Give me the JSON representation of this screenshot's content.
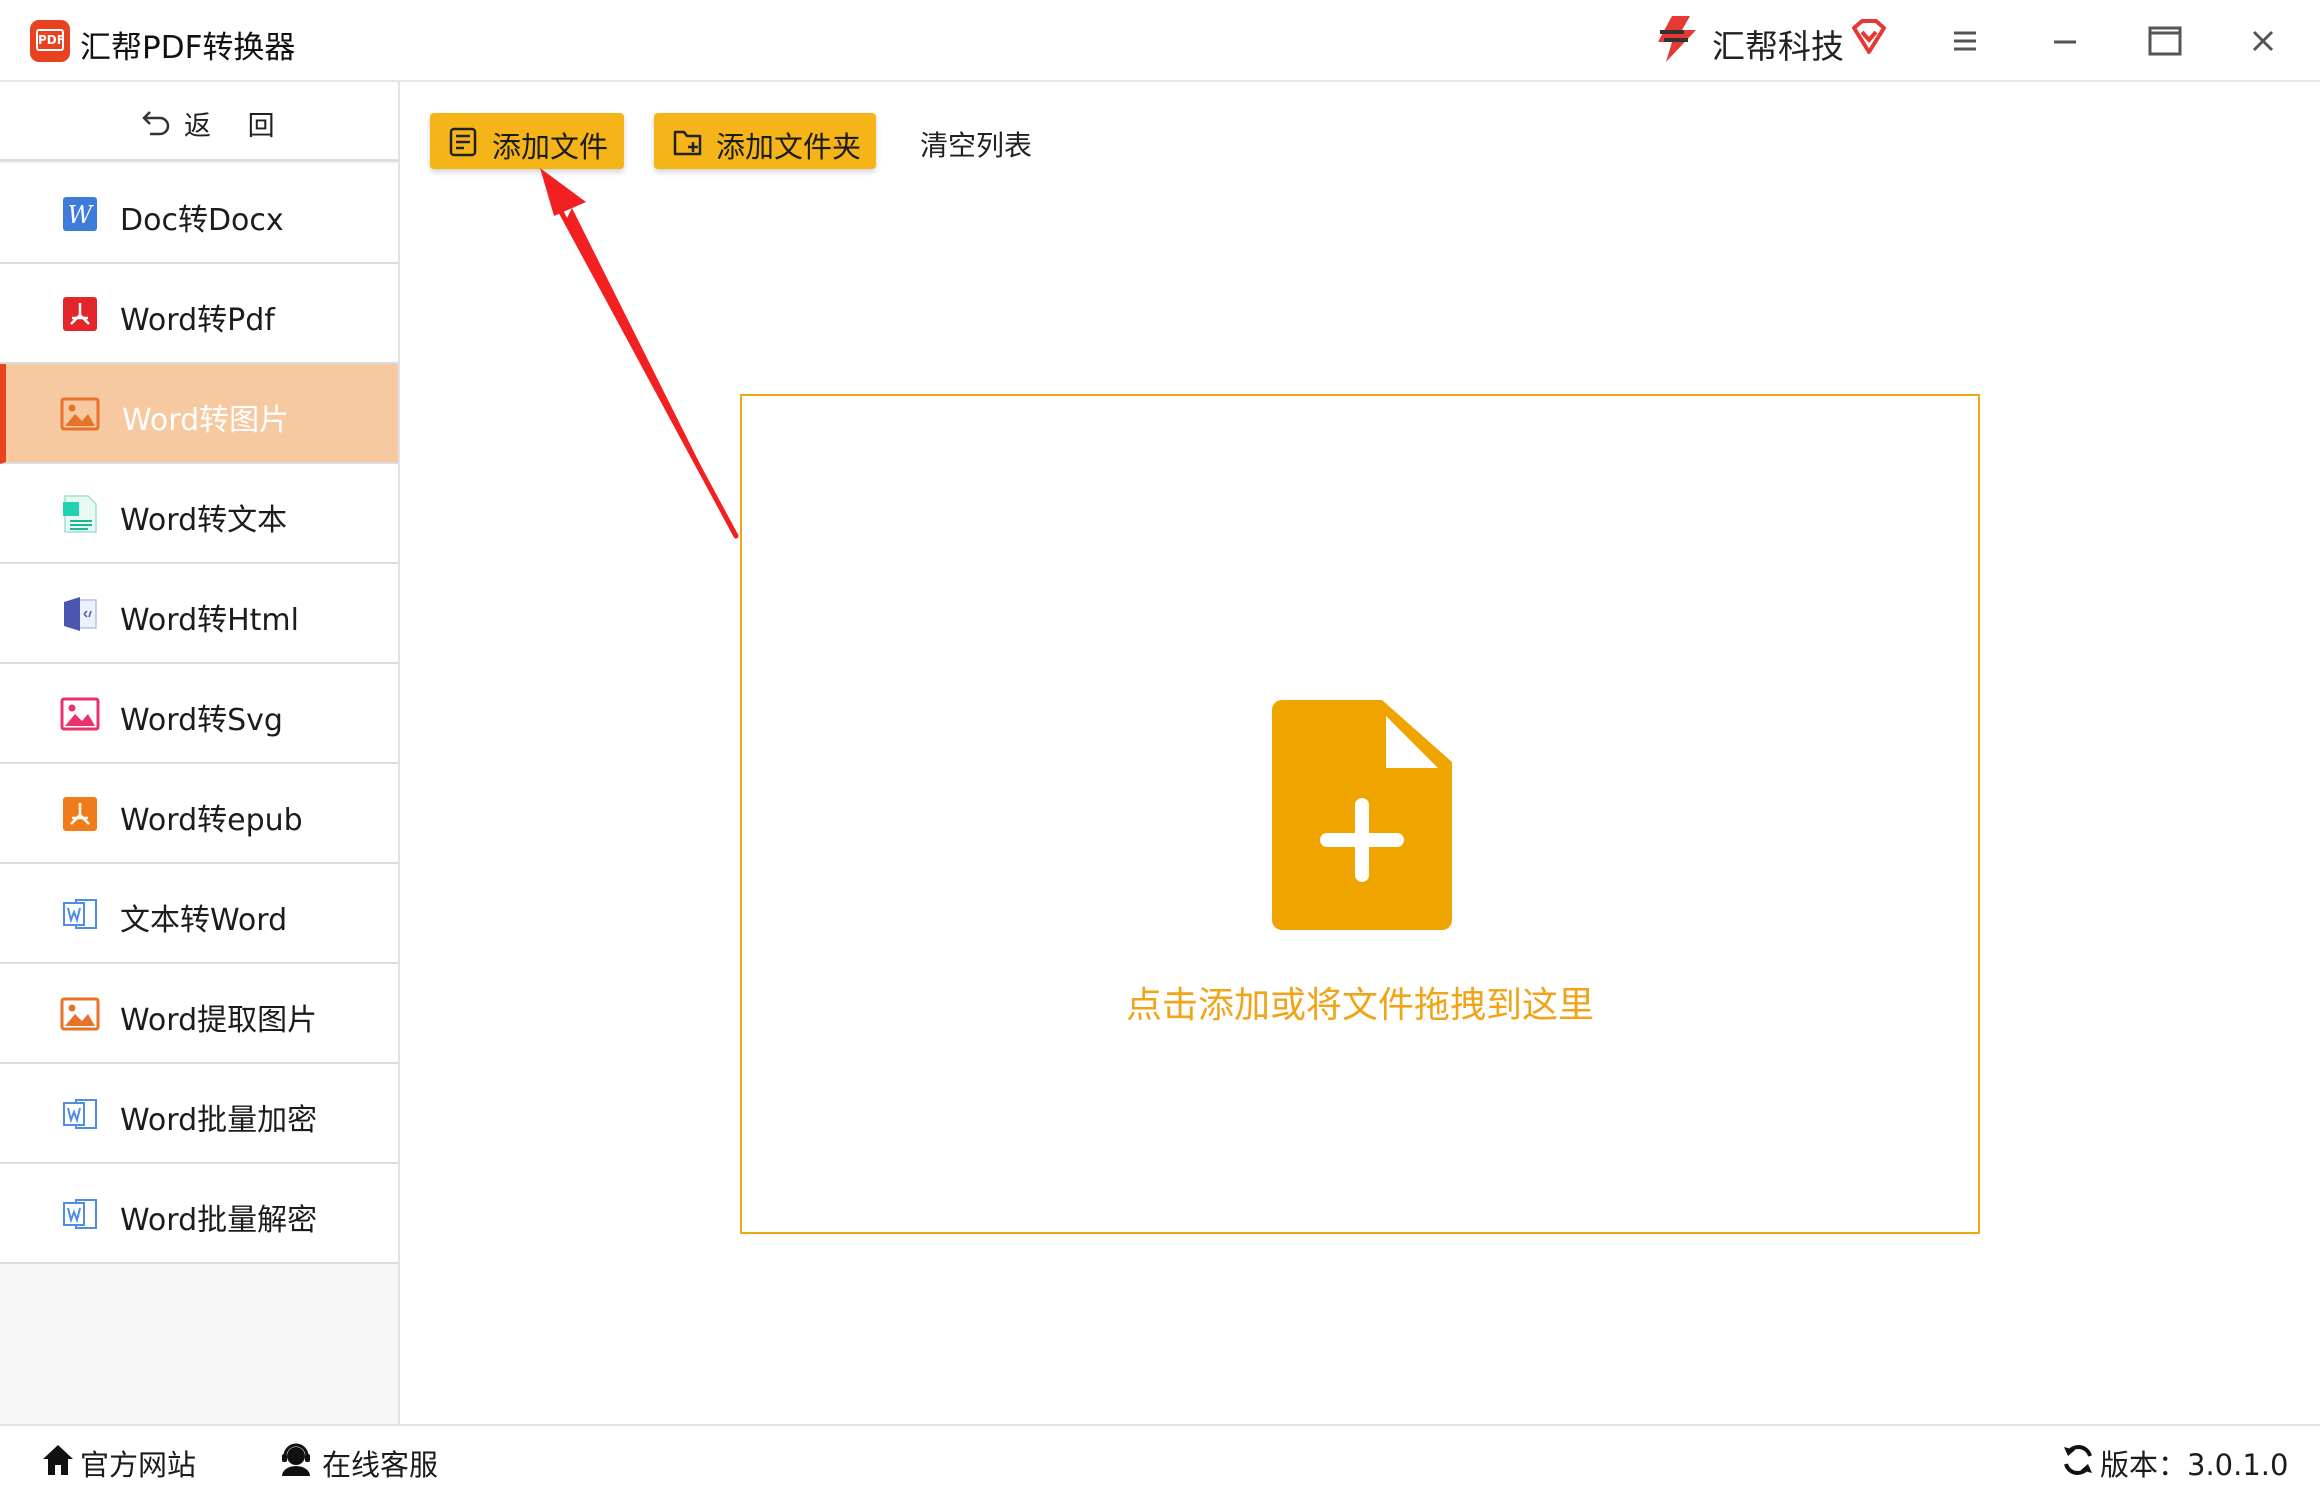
{
  "window": {
    "title": "汇帮PDF转换器",
    "brand": "汇帮科技",
    "logo_text": "PDF",
    "accent": "#f5b417",
    "highlight": "#f0a418",
    "active_bg": "#f7c9a0",
    "active_marker": "#e8421f"
  },
  "sidebar": {
    "back_label": "返 回",
    "items": [
      {
        "label": "Doc转Docx",
        "icon": "word-w-icon",
        "active": false
      },
      {
        "label": "Word转Pdf",
        "icon": "pdf-acrobat-icon",
        "active": false
      },
      {
        "label": "Word转图片",
        "icon": "image-icon",
        "active": true
      },
      {
        "label": "Word转文本",
        "icon": "text-file-icon",
        "active": false
      },
      {
        "label": "Word转Html",
        "icon": "html-file-icon",
        "active": false
      },
      {
        "label": "Word转Svg",
        "icon": "svg-image-icon",
        "active": false
      },
      {
        "label": "Word转epub",
        "icon": "epub-icon",
        "active": false
      },
      {
        "label": "文本转Word",
        "icon": "word-outline-icon",
        "active": false
      },
      {
        "label": "Word提取图片",
        "icon": "image-icon",
        "active": false
      },
      {
        "label": "Word批量加密",
        "icon": "word-outline-icon",
        "active": false
      },
      {
        "label": "Word批量解密",
        "icon": "word-outline-icon",
        "active": false
      }
    ]
  },
  "toolbar": {
    "add_file": "添加文件",
    "add_folder": "添加文件夹",
    "clear_list": "清空列表"
  },
  "dropzone": {
    "hint": "点击添加或将文件拖拽到这里"
  },
  "statusbar": {
    "website": "官方网站",
    "support": "在线客服",
    "version": "版本：3.0.1.0"
  }
}
